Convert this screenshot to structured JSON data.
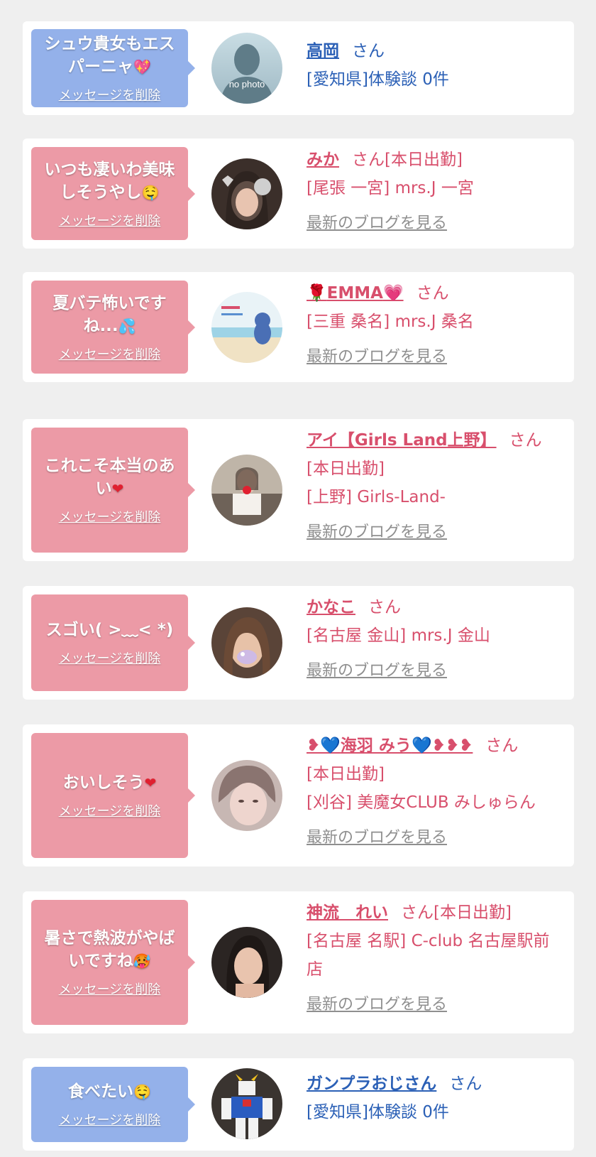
{
  "delete_label": "メッセージを削除",
  "san_label": "さん",
  "blog_label": "最新のブログを見る",
  "colors": {
    "background": "#efefef",
    "card": "#ffffff",
    "bubble_pink": "#ec9aa6",
    "bubble_blue": "#94b1ea",
    "name_pink": "#d84f6c",
    "name_blue": "#2b60b6",
    "blog_gray": "#8f8f8f"
  },
  "messages": [
    {
      "message": "シュウ貴女もエスパーニャ",
      "message_emoji": "💖",
      "theme": "blue",
      "avatar_icon": "no-photo-avatar-icon",
      "avatar_text": "no photo",
      "name": "高岡",
      "status": "",
      "shop": "[愛知県]体験談 0件"
    },
    {
      "message": "いつも凄いわ美味しそうやし",
      "message_emoji": "🤤",
      "theme": "pink",
      "avatar_icon": "girl-photo-avatar-icon",
      "name": "みか",
      "status": "[本日出勤]",
      "shop": "[尾張 一宮] mrs.J 一宮"
    },
    {
      "message": "夏バテ怖いですね...",
      "message_emoji": "💦",
      "theme": "pink",
      "avatar_icon": "beach-photo-avatar-icon",
      "name_prefix": "🌹",
      "name": "EMMA",
      "name_suffix": "💗",
      "status": "",
      "shop": "[三重 桑名] mrs.J 桑名"
    },
    {
      "message": "これこそ本当のあい",
      "message_emoji": "❤",
      "theme": "pink",
      "avatar_icon": "girl-photo-avatar-icon",
      "name": "アイ【Girls Land上野】",
      "status": "[本日出勤]",
      "shop": "[上野] Girls-Land-"
    },
    {
      "message": "スゴい( >﹏< *)",
      "message_emoji": "",
      "theme": "pink",
      "avatar_icon": "girl-photo-avatar-icon",
      "name": "かなこ",
      "status": "",
      "shop": "[名古屋 金山] mrs.J 金山"
    },
    {
      "message": "おいしそう",
      "message_emoji": "❤",
      "theme": "pink",
      "avatar_icon": "girl-photo-avatar-icon",
      "name_prefix": "❥💙",
      "name": "海羽 みう",
      "name_suffix": "💙❥❥❥",
      "status": "[本日出勤]",
      "shop": "[刈谷] 美魔女CLUB みしゅらん"
    },
    {
      "message": "暑さで熱波がやばいですね",
      "message_emoji": "🥵",
      "theme": "pink",
      "avatar_icon": "girl-photo-avatar-icon",
      "name": "神流　れい",
      "status": "[本日出勤]",
      "shop": "[名古屋 名駅] C-club 名古屋駅前店"
    },
    {
      "message": "食べたい",
      "message_emoji": "🤤",
      "theme": "blue",
      "avatar_icon": "robot-figure-avatar-icon",
      "name": "ガンプラおじさん",
      "status": "",
      "shop": "[愛知県]体験談 0件"
    }
  ]
}
